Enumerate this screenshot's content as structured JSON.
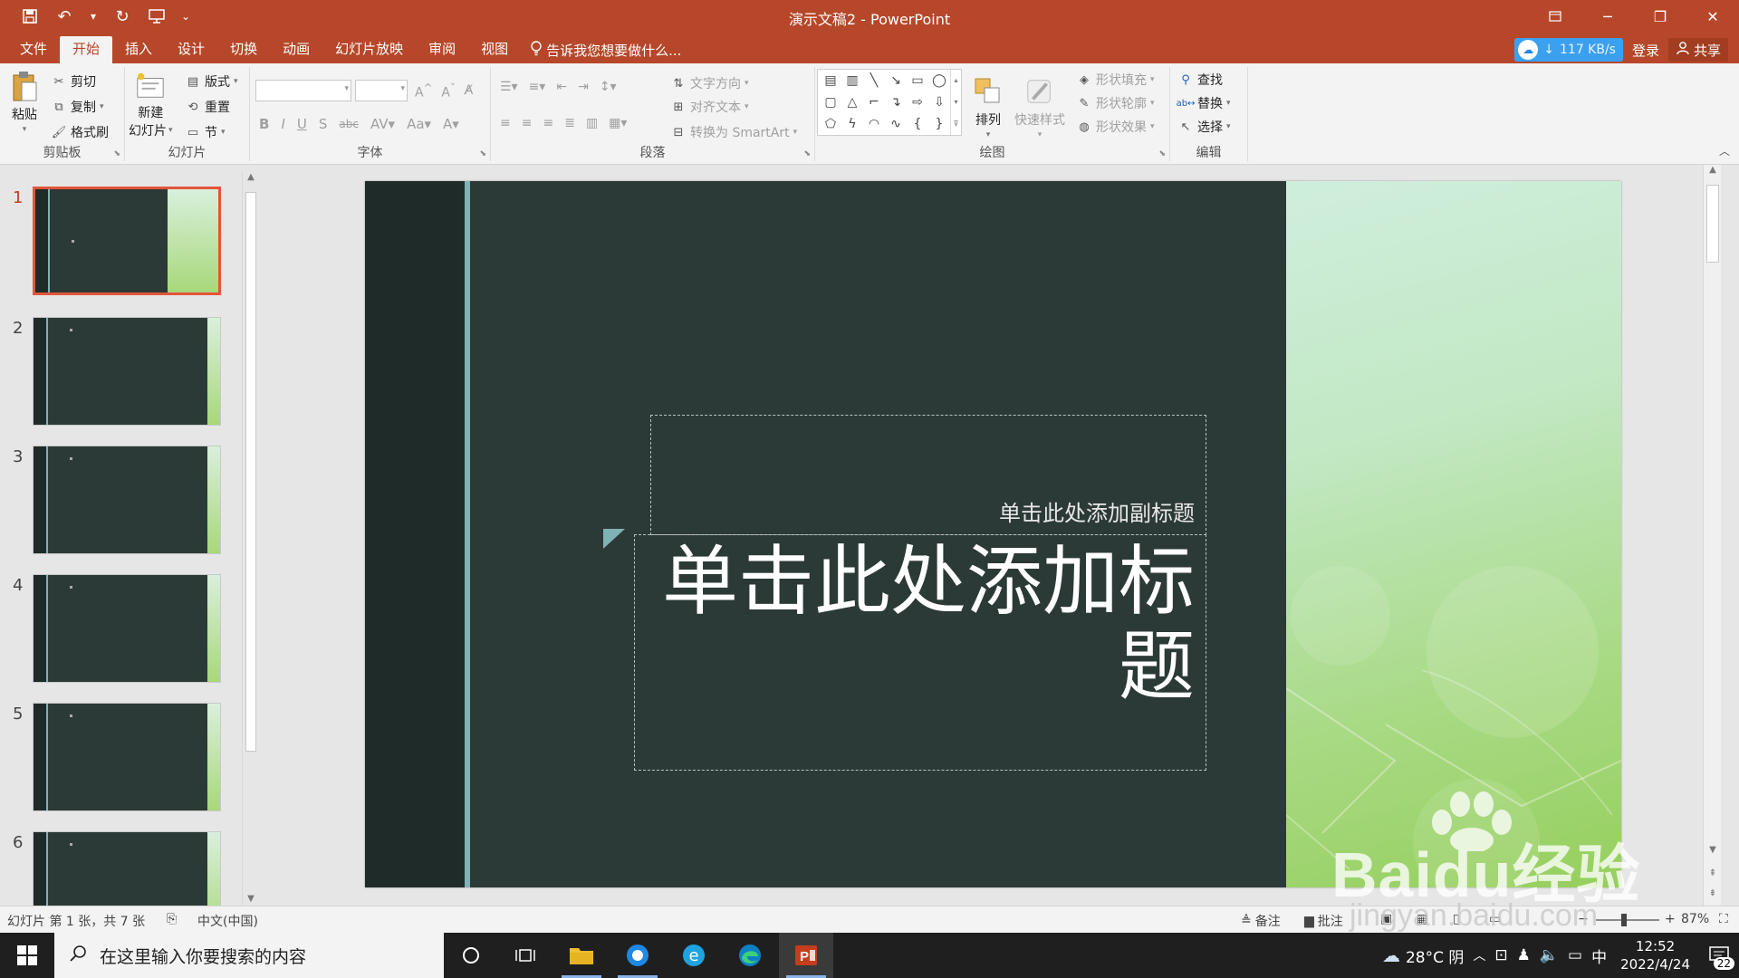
{
  "window": {
    "title": "演示文稿2 - PowerPoint"
  },
  "tabs": [
    {
      "label": "文件"
    },
    {
      "label": "开始"
    },
    {
      "label": "插入"
    },
    {
      "label": "设计"
    },
    {
      "label": "切换"
    },
    {
      "label": "动画"
    },
    {
      "label": "幻灯片放映"
    },
    {
      "label": "审阅"
    },
    {
      "label": "视图"
    }
  ],
  "active_tab": "开始",
  "tell_me": "告诉我您想要做什么...",
  "account": {
    "speed": "117 KB/s",
    "login": "登录",
    "share": "共享"
  },
  "ribbon": {
    "clipboard": {
      "paste": "粘贴",
      "cut": "剪切",
      "copy": "复制",
      "format_painter": "格式刷",
      "label": "剪贴板"
    },
    "slides": {
      "new_slide_line1": "新建",
      "new_slide_line2": "幻灯片",
      "layout": "版式",
      "reset": "重置",
      "section": "节",
      "label": "幻灯片"
    },
    "font": {
      "label": "字体"
    },
    "paragraph": {
      "text_direction": "文字方向",
      "align_text": "对齐文本",
      "convert_smartart": "转换为 SmartArt",
      "label": "段落"
    },
    "drawing": {
      "arrange": "排列",
      "quick_styles": "快速样式",
      "shape_fill": "形状填充",
      "shape_outline": "形状轮廓",
      "shape_effects": "形状效果",
      "label": "绘图"
    },
    "editing": {
      "find": "查找",
      "replace": "替换",
      "select": "选择",
      "label": "编辑"
    }
  },
  "thumbnails": [
    {
      "number": "1"
    },
    {
      "number": "2"
    },
    {
      "number": "3"
    },
    {
      "number": "4"
    },
    {
      "number": "5"
    },
    {
      "number": "6"
    }
  ],
  "slide": {
    "subtitle_placeholder": "单击此处添加副标题",
    "title_placeholder": "单击此处添加标题",
    "colors": {
      "background": "#2c3a37",
      "band": "#1f2b28",
      "accent": "#7fb3b6",
      "green_light": "#cfeedd",
      "green_dark": "#96cf5d"
    }
  },
  "status": {
    "slide_info": "幻灯片 第 1 张，共 7 张",
    "language": "中文(中国)",
    "notes": "备注",
    "comments": "批注",
    "zoom": "87%"
  },
  "taskbar": {
    "search_placeholder": "在这里输入你要搜索的内容",
    "weather": "28°C 阴",
    "ime": "中",
    "time": "12:52",
    "date": "2022/4/24",
    "notifications": "22"
  },
  "watermark": {
    "text": "Baidu经验",
    "url": "jingyan.baidu.com"
  }
}
